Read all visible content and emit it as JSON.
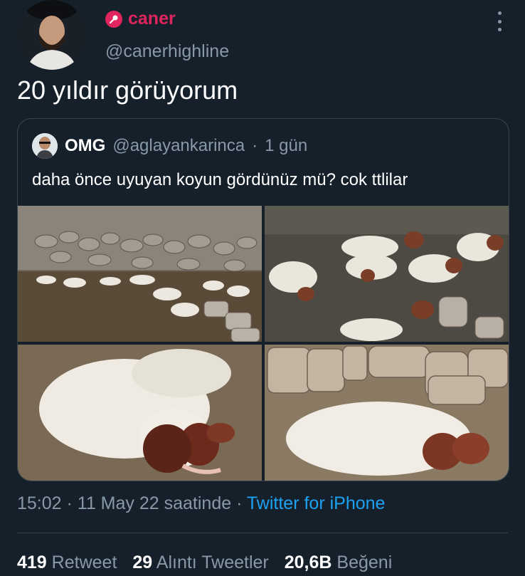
{
  "author": {
    "display_name": "caner",
    "handle": "@canerhighline",
    "badge_icon": "microphone-icon",
    "accent_color": "#e0245e"
  },
  "tweet": {
    "text": "20 yıldır görüyorum"
  },
  "quoted": {
    "name": "OMG",
    "handle": "@aglayankarinca",
    "separator": "·",
    "time": "1 gün",
    "text": "daha önce uyuyan koyun gördünüz mü? cok ttlilar",
    "photos": [
      "sheep-yard-photo",
      "sheep-group-photo",
      "sheep-closeup-photo",
      "sheep-by-wall-photo"
    ]
  },
  "meta": {
    "time": "15:02 · 11 May 22 saatinde",
    "separator": "·",
    "source": "Twitter for iPhone"
  },
  "stats": [
    {
      "count": "419",
      "label": "Retweet"
    },
    {
      "count": "29",
      "label": "Alıntı Tweetler"
    },
    {
      "count": "20,6B",
      "label": "Beğeni"
    }
  ],
  "colors": {
    "background": "#15202b",
    "muted": "#8899a6",
    "link": "#1da1f2",
    "border": "#38444d"
  }
}
